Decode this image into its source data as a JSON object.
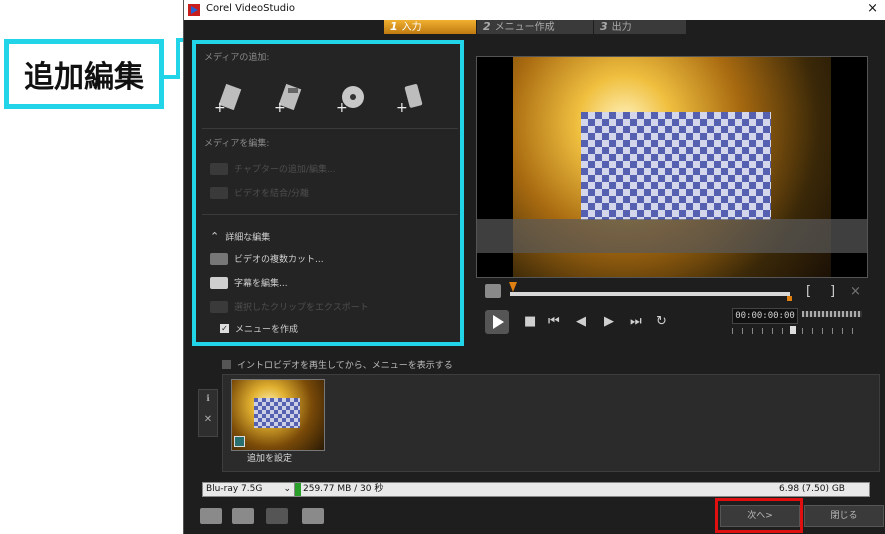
{
  "callout": {
    "label": "追加編集"
  },
  "window": {
    "title": "Corel VideoStudio",
    "close": "×"
  },
  "steps": [
    {
      "num": "1",
      "label": "入力"
    },
    {
      "num": "2",
      "label": "メニュー作成"
    },
    {
      "num": "3",
      "label": "出力"
    }
  ],
  "left_panel": {
    "add_media_title": "メディアの追加:",
    "media_icons": [
      "video-clip-icon",
      "vr-clip-icon",
      "disc-import-icon",
      "mobile-device-icon"
    ],
    "edit_media_title": "メディアを編集:",
    "edit_items": [
      {
        "label": "チャプターの追加/編集...",
        "enabled": false
      },
      {
        "label": "ビデオを結合/分離",
        "enabled": false
      }
    ],
    "advanced_items": [
      {
        "label": "詳細な編集",
        "enabled": true
      },
      {
        "label": "ビデオの複数カット...",
        "enabled": true
      },
      {
        "label": "字幕を編集...",
        "enabled": true
      },
      {
        "label": "選択したクリップをエクスポート",
        "enabled": false
      }
    ],
    "create_menu": {
      "label": "メニューを作成",
      "checked": true
    }
  },
  "player": {
    "timecode": "00:00:00:00",
    "mark_in": "[",
    "mark_out": "]",
    "clear": "×"
  },
  "intro_option": {
    "label": "イントロビデオを再生してから、メニューを表示する",
    "checked": false
  },
  "thumbnail": {
    "label": "追加を設定"
  },
  "sidebar_strip": {
    "info": "ℹ",
    "remove": "✕"
  },
  "disc": {
    "type": "Blu-ray  7.5G",
    "usage": "259.77 MB / 30 秒",
    "capacity": "6.98 (7.50) GB",
    "usage_fraction": 0.01
  },
  "buttons": {
    "next": "次へ>",
    "close": "閉じる"
  },
  "colors": {
    "accent": "#21d4e8",
    "step_active": "#e0a020",
    "highlight": "#e01010"
  }
}
